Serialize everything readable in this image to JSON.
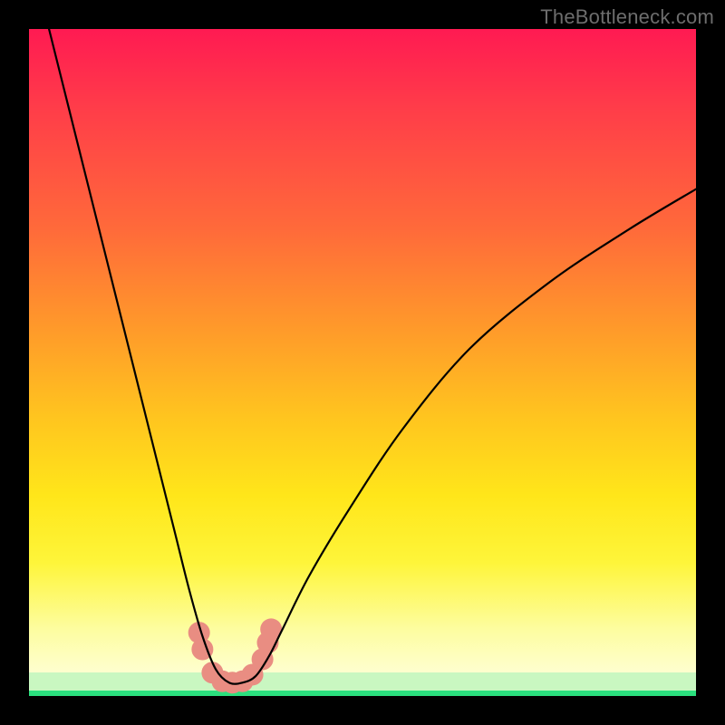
{
  "watermark": "TheBottleneck.com",
  "chart_data": {
    "type": "line",
    "title": "",
    "xlabel": "",
    "ylabel": "",
    "xlim": [
      0,
      100
    ],
    "ylim": [
      0,
      100
    ],
    "grid": false,
    "legend": false,
    "series": [
      {
        "name": "bottleneck-curve",
        "color": "#000000",
        "x": [
          3,
          6,
          9,
          12,
          15,
          18,
          20,
          22,
          24,
          26,
          28,
          30,
          32,
          34,
          36,
          38,
          42,
          48,
          56,
          66,
          78,
          90,
          100
        ],
        "y": [
          100,
          88,
          76,
          64,
          52,
          40,
          32,
          24,
          16,
          9,
          4,
          2,
          2,
          3,
          6,
          10,
          18,
          28,
          40,
          52,
          62,
          70,
          76
        ]
      }
    ],
    "markers": [
      {
        "name": "highlight-dots",
        "color": "#e98d82",
        "shape": "circle",
        "r": 12,
        "points": [
          {
            "x": 25.5,
            "y": 9.5
          },
          {
            "x": 26.0,
            "y": 7.0
          },
          {
            "x": 27.5,
            "y": 3.5
          },
          {
            "x": 29.0,
            "y": 2.2
          },
          {
            "x": 30.5,
            "y": 2.0
          },
          {
            "x": 32.0,
            "y": 2.2
          },
          {
            "x": 33.5,
            "y": 3.2
          },
          {
            "x": 35.0,
            "y": 5.5
          },
          {
            "x": 35.8,
            "y": 8.0
          },
          {
            "x": 36.3,
            "y": 10.0
          }
        ]
      }
    ],
    "background": {
      "gradient_stops": [
        {
          "pos": 0.0,
          "color": "#ff1a52"
        },
        {
          "pos": 0.3,
          "color": "#ff6a3a"
        },
        {
          "pos": 0.58,
          "color": "#ffc41f"
        },
        {
          "pos": 0.8,
          "color": "#fef53a"
        },
        {
          "pos": 0.965,
          "color": "#fefecf"
        },
        {
          "pos": 0.992,
          "color": "#c9f7c1"
        },
        {
          "pos": 1.0,
          "color": "#2be07e"
        }
      ]
    }
  }
}
